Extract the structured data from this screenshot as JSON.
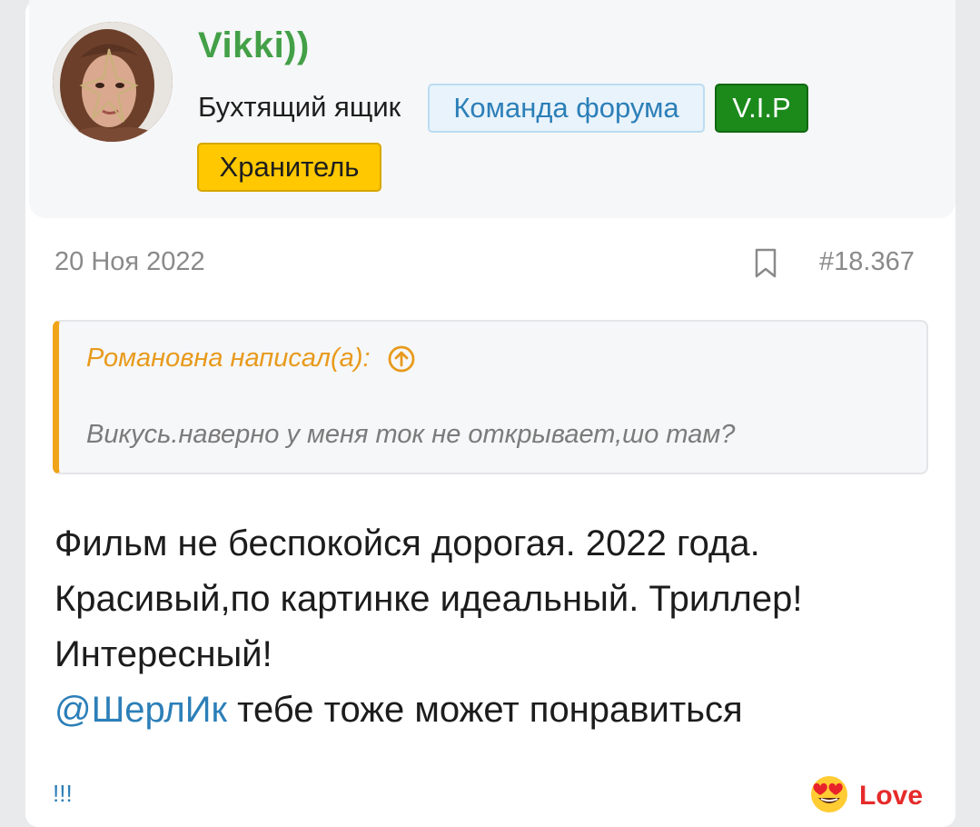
{
  "post": {
    "author": {
      "username": "Vikki))",
      "user_title": "Бухтящий ящик",
      "badges": {
        "team": "Команда форума",
        "vip": "V.I.P",
        "keeper": "Хранитель"
      }
    },
    "date": "20 Ноя 2022",
    "number": "#18.367",
    "quote": {
      "author_line": "Романовна написал(а):",
      "text": "Викусь.наверно у меня ток не открывает,шо там?"
    },
    "body": {
      "line1": "Фильм не беспокойся дорогая. 2022 года.",
      "line2": "Красивый,по картинке идеальный. Триллер!",
      "line3": "Интересный!",
      "mention": "@ШерлИк",
      "line4_rest": " тебе тоже может понравиться"
    },
    "signature": "!!!",
    "reaction": {
      "label": "Love",
      "icon": "heart-eyes-emoji-icon"
    }
  },
  "colors": {
    "username": "#43a047",
    "link": "#2c7fb8",
    "quote_accent": "#f0a417",
    "vip": "#1b8a1b",
    "keeper": "#ffc800",
    "love": "#e52b2b"
  }
}
